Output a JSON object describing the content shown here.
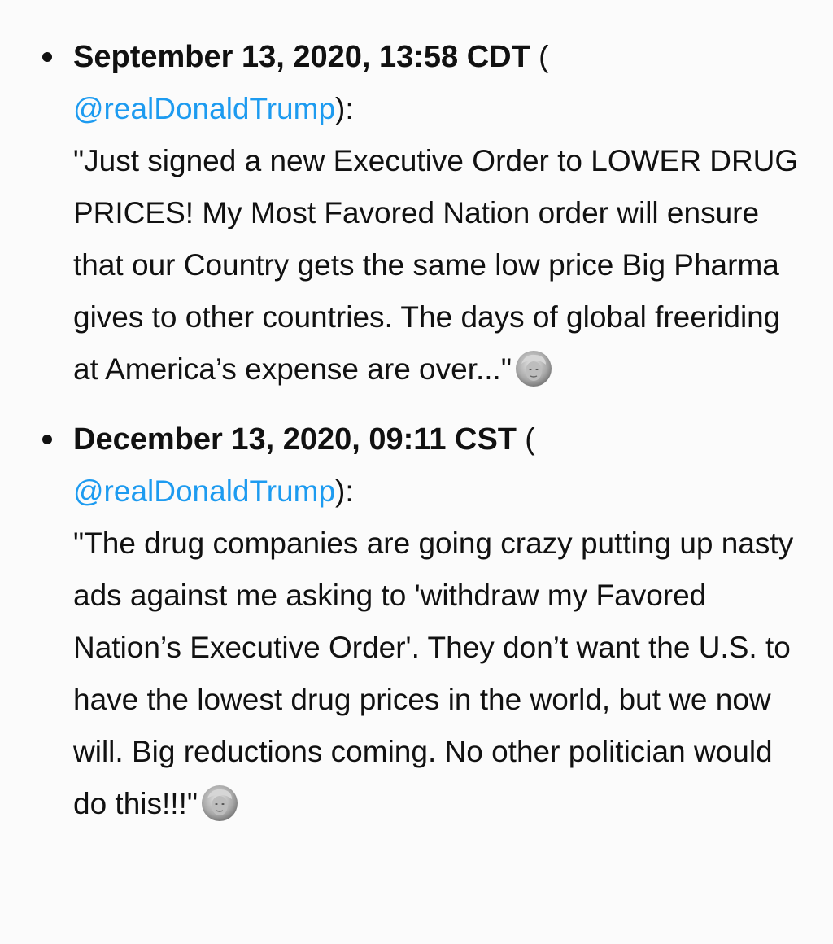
{
  "posts": [
    {
      "timestamp": "September 13, 2020, 13:58 CDT",
      "open_paren": " (",
      "handle": "@realDonaldTrump",
      "close_paren": "):",
      "quote": "\"Just signed a new Executive Order to LOWER DRUG PRICES! My Most Favored Nation order will ensure that our Country gets the same low price Big Pharma gives to other countries. The days of global freeriding at America’s expense are over...\"",
      "avatar_icon": "profile-avatar-icon"
    },
    {
      "timestamp": "December 13, 2020, 09:11 CST",
      "open_paren": " (",
      "handle": "@realDonaldTrump",
      "close_paren": "):",
      "quote": "\"The drug companies are going crazy putting up nasty ads against me asking to 'withdraw my Favored Nation’s Executive Order'. They don’t want the U.S. to have the lowest drug prices in the world, but we now will. Big reductions coming. No other politician would do this!!!\"",
      "avatar_icon": "profile-avatar-icon"
    }
  ],
  "colors": {
    "link": "#1d9bf0",
    "text": "#111111",
    "background": "#fbfbfb"
  }
}
